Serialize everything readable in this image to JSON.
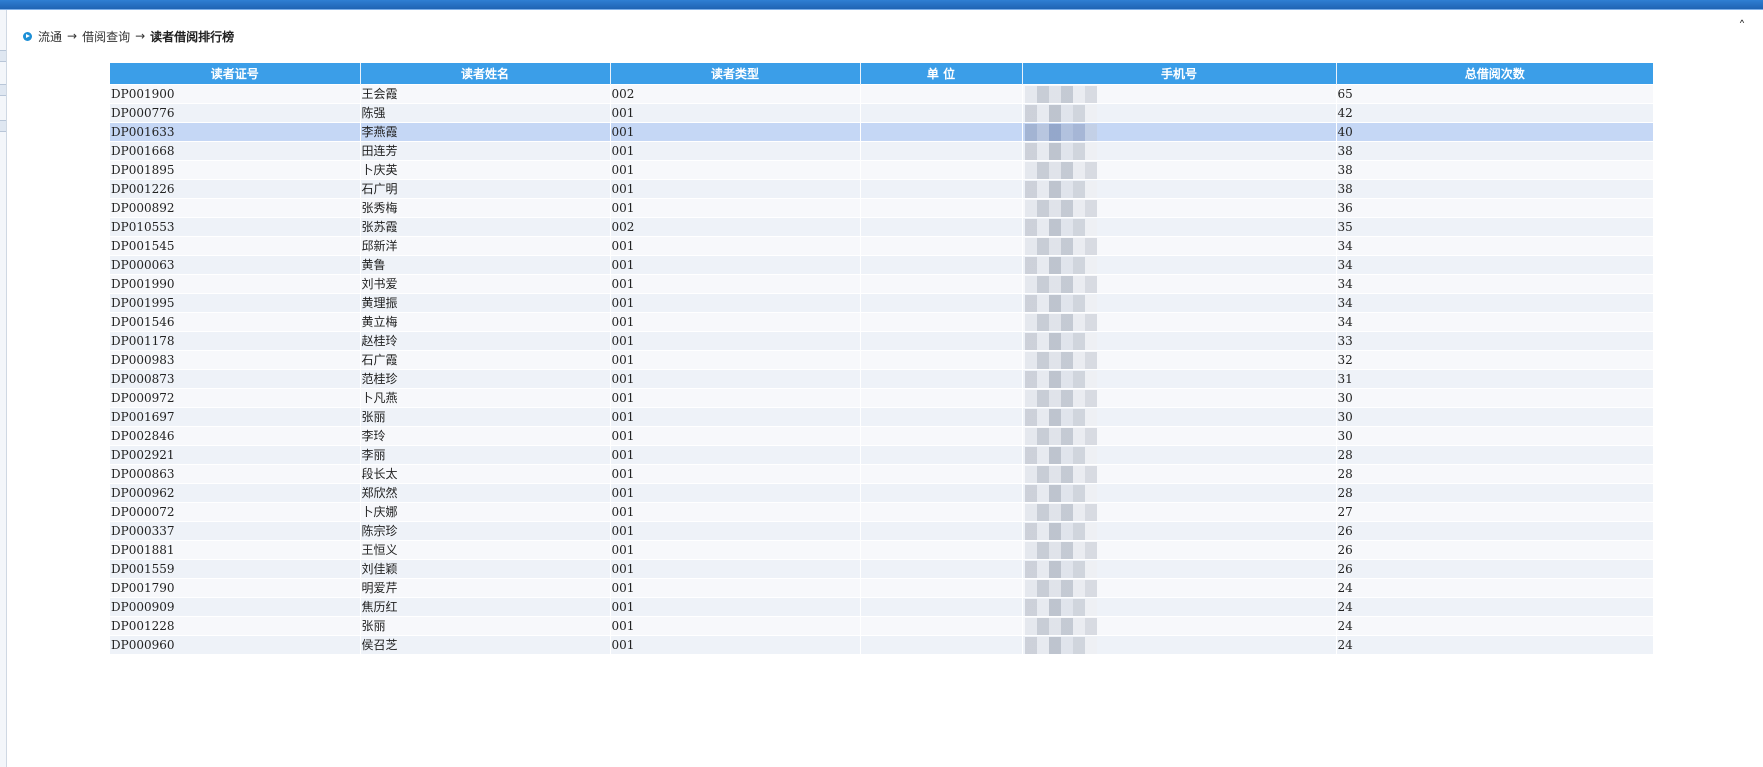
{
  "breadcrumb": {
    "item1": "流通",
    "sep": "→",
    "item2": "借阅查询",
    "current": "读者借阅排行榜"
  },
  "table": {
    "headers": [
      "读者证号",
      "读者姓名",
      "读者类型",
      "单 位",
      "手机号",
      "总借阅次数"
    ],
    "rows": [
      {
        "id": "DP001900",
        "name": "王会霞",
        "type": "002",
        "unit": "",
        "count": "65"
      },
      {
        "id": "DP000776",
        "name": "陈强",
        "type": "001",
        "unit": "",
        "count": "42"
      },
      {
        "id": "DP001633",
        "name": "李燕霞",
        "type": "001",
        "unit": "",
        "count": "40"
      },
      {
        "id": "DP001668",
        "name": "田连芳",
        "type": "001",
        "unit": "",
        "count": "38"
      },
      {
        "id": "DP001895",
        "name": "卜庆英",
        "type": "001",
        "unit": "",
        "count": "38"
      },
      {
        "id": "DP001226",
        "name": "石广明",
        "type": "001",
        "unit": "",
        "count": "38"
      },
      {
        "id": "DP000892",
        "name": "张秀梅",
        "type": "001",
        "unit": "",
        "count": "36"
      },
      {
        "id": "DP010553",
        "name": "张苏霞",
        "type": "002",
        "unit": "",
        "count": "35"
      },
      {
        "id": "DP001545",
        "name": "邱新洋",
        "type": "001",
        "unit": "",
        "count": "34"
      },
      {
        "id": "DP000063",
        "name": "黄鲁",
        "type": "001",
        "unit": "",
        "count": "34"
      },
      {
        "id": "DP001990",
        "name": "刘书爱",
        "type": "001",
        "unit": "",
        "count": "34"
      },
      {
        "id": "DP001995",
        "name": "黄理振",
        "type": "001",
        "unit": "",
        "count": "34"
      },
      {
        "id": "DP001546",
        "name": "黄立梅",
        "type": "001",
        "unit": "",
        "count": "34"
      },
      {
        "id": "DP001178",
        "name": "赵桂玲",
        "type": "001",
        "unit": "",
        "count": "33"
      },
      {
        "id": "DP000983",
        "name": "石广霞",
        "type": "001",
        "unit": "",
        "count": "32"
      },
      {
        "id": "DP000873",
        "name": "范桂珍",
        "type": "001",
        "unit": "",
        "count": "31"
      },
      {
        "id": "DP000972",
        "name": "卜凡燕",
        "type": "001",
        "unit": "",
        "count": "30"
      },
      {
        "id": "DP001697",
        "name": "张丽",
        "type": "001",
        "unit": "",
        "count": "30"
      },
      {
        "id": "DP002846",
        "name": "李玲",
        "type": "001",
        "unit": "",
        "count": "30"
      },
      {
        "id": "DP002921",
        "name": "李丽",
        "type": "001",
        "unit": "",
        "count": "28"
      },
      {
        "id": "DP000863",
        "name": "段长太",
        "type": "001",
        "unit": "",
        "count": "28"
      },
      {
        "id": "DP000962",
        "name": "郑欣然",
        "type": "001",
        "unit": "",
        "count": "28"
      },
      {
        "id": "DP000072",
        "name": "卜庆娜",
        "type": "001",
        "unit": "",
        "count": "27"
      },
      {
        "id": "DP000337",
        "name": "陈宗珍",
        "type": "001",
        "unit": "",
        "count": "26"
      },
      {
        "id": "DP001881",
        "name": "王恒义",
        "type": "001",
        "unit": "",
        "count": "26"
      },
      {
        "id": "DP001559",
        "name": "刘佳颖",
        "type": "001",
        "unit": "",
        "count": "26"
      },
      {
        "id": "DP001790",
        "name": "明爱芹",
        "type": "001",
        "unit": "",
        "count": "24"
      },
      {
        "id": "DP000909",
        "name": "焦历红",
        "type": "001",
        "unit": "",
        "count": "24"
      },
      {
        "id": "DP001228",
        "name": "张丽",
        "type": "001",
        "unit": "",
        "count": "24"
      },
      {
        "id": "DP000960",
        "name": "侯召芝",
        "type": "001",
        "unit": "",
        "count": "24"
      }
    ],
    "selected_row": 2
  },
  "icons": {
    "breadcrumb": "arrow-circle-icon",
    "collapse": "caret-up-icon"
  },
  "colors": {
    "header_bg": "#3b9ee8",
    "selected_row": "#c5d7f5"
  }
}
